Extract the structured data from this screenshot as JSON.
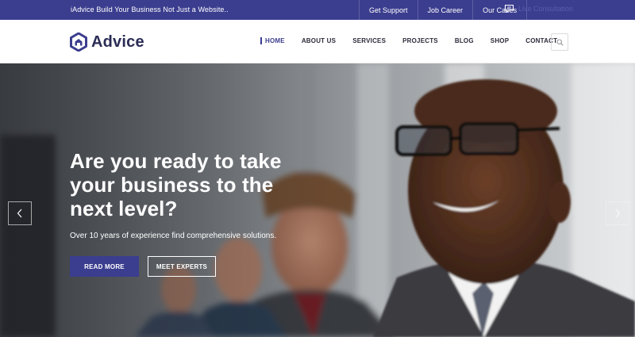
{
  "topbar": {
    "tagline": "iAdvice Build Your Business Not Just a Website..",
    "links": [
      "Get Support",
      "Job Career",
      "Our Cases"
    ],
    "chat_label": "Live Consultation",
    "bg_color": "#3b3d8f"
  },
  "header": {
    "logo_text": "Advice",
    "logo_icon": "hexagon-house-icon",
    "nav": [
      {
        "label": "HOME",
        "active": true
      },
      {
        "label": "ABOUT US",
        "active": false
      },
      {
        "label": "SERVICES",
        "active": false
      },
      {
        "label": "PROJECTS",
        "active": false
      },
      {
        "label": "BLOG",
        "active": false
      },
      {
        "label": "SHOP",
        "active": false
      },
      {
        "label": "CONTACT",
        "active": false
      }
    ],
    "search_icon": "search-icon"
  },
  "hero": {
    "title_line1": "Are you ready to take",
    "title_line2": "your business to the",
    "title_line3": "next level?",
    "subtitle": "Over 10 years of experience find comprehensive solutions.",
    "primary_button": "READ MORE",
    "secondary_button": "MEET EXPERTS",
    "prev_icon": "chevron-left-icon",
    "next_icon": "chevron-right-icon",
    "accent_color": "#3b3d8f"
  }
}
